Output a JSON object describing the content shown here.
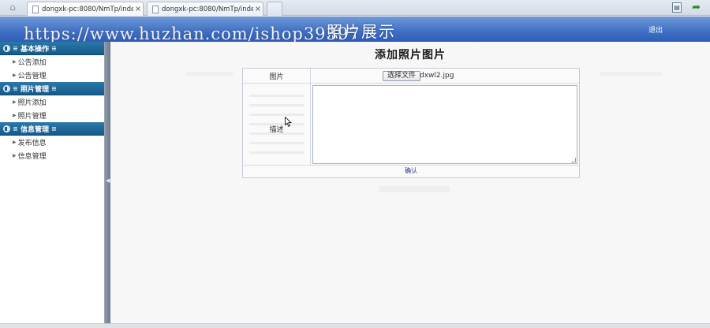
{
  "browser": {
    "tabs": [
      {
        "title": "dongxk-pc:8080/NmTp/inde"
      },
      {
        "title": "dongxk-pc:8080/NmTp/inde"
      }
    ],
    "close_glyph": "×"
  },
  "header": {
    "watermark": "https://www.huzhan.com/ishop39397",
    "title": "照片展示",
    "logout_label": "退出"
  },
  "sidebar": {
    "groups": [
      {
        "label": "基本操作",
        "items": [
          {
            "label": "公告添加"
          },
          {
            "label": "公告管理"
          }
        ]
      },
      {
        "label": "照片管理",
        "items": [
          {
            "label": "照片添加"
          },
          {
            "label": "照片管理"
          }
        ]
      },
      {
        "label": "信息管理",
        "items": [
          {
            "label": "发布信息"
          },
          {
            "label": "信息管理"
          }
        ]
      }
    ]
  },
  "form": {
    "page_title": "添加照片图片",
    "image_label": "图片",
    "file_button_label": "选择文件",
    "file_name": "dxwl2.jpg",
    "description_label": "描述",
    "confirm_label": "确认"
  },
  "colors": {
    "header_blue": "#3f6fc4",
    "sidebar_group": "#155b8a"
  }
}
